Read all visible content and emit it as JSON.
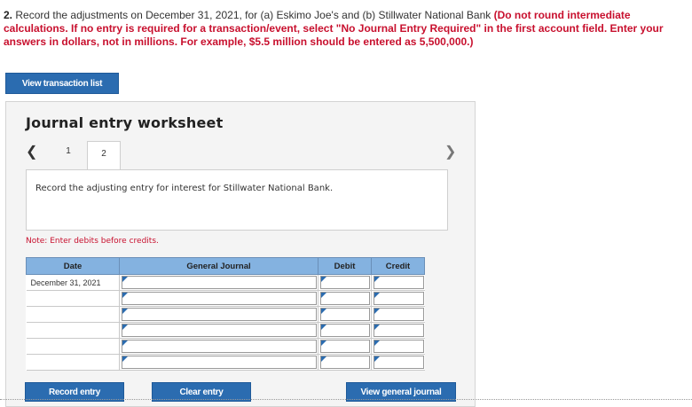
{
  "question": {
    "number": "2.",
    "text": "Record the adjustments on December 31, 2021, for (a) Eskimo Joe's and (b) Stillwater National Bank",
    "warning": "(Do not round intermediate calculations. If no entry is required for a transaction/event, select \"No Journal Entry Required\" in the first account field. Enter your answers in dollars, not in millions. For example, $5.5 million should be entered as 5,500,000.)"
  },
  "buttons": {
    "view_transaction_list": "View transaction list",
    "record_entry": "Record entry",
    "clear_entry": "Clear entry",
    "view_general_journal": "View general journal"
  },
  "worksheet": {
    "title": "Journal entry worksheet",
    "tabs": [
      "1",
      "2"
    ],
    "active_tab": "2",
    "prev_icon": "chevron-left-icon",
    "next_icon": "chevron-right-icon",
    "instruction": "Record the adjusting entry for interest for Stillwater National Bank.",
    "note": "Note: Enter debits before credits."
  },
  "journal": {
    "headers": [
      "Date",
      "General Journal",
      "Debit",
      "Credit"
    ],
    "rows": [
      {
        "date": "December 31, 2021",
        "account": "",
        "debit": "",
        "credit": ""
      },
      {
        "date": "",
        "account": "",
        "debit": "",
        "credit": ""
      },
      {
        "date": "",
        "account": "",
        "debit": "",
        "credit": ""
      },
      {
        "date": "",
        "account": "",
        "debit": "",
        "credit": ""
      },
      {
        "date": "",
        "account": "",
        "debit": "",
        "credit": ""
      },
      {
        "date": "",
        "account": "",
        "debit": "",
        "credit": ""
      }
    ]
  },
  "colors": {
    "button_blue": "#2b6cb0",
    "header_blue": "#84b2e0",
    "warning_red": "#c8102e"
  }
}
